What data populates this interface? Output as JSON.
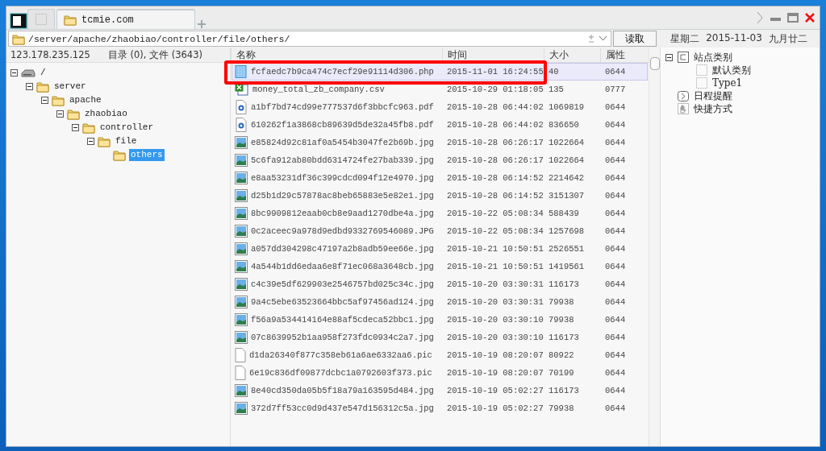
{
  "tabs": [
    {
      "kind": "blank",
      "selected": false
    },
    {
      "kind": "folder",
      "label": "tcmie.com",
      "selected": true
    }
  ],
  "address_bar": {
    "path": "/server/apache/zhaobiao/controller/file/others/",
    "button": "读取"
  },
  "left_panel": {
    "host": "123.178.235.125",
    "summary": "目录 (0), 文件 (3643)",
    "tree": [
      {
        "kind": "drive",
        "label": "/",
        "expanded": true,
        "selected": false,
        "children": [
          {
            "kind": "folder",
            "label": "server",
            "expanded": true,
            "selected": false,
            "children": [
              {
                "kind": "folder",
                "label": "apache",
                "expanded": true,
                "selected": false,
                "children": [
                  {
                    "kind": "folder",
                    "label": "zhaobiao",
                    "expanded": true,
                    "selected": false,
                    "children": [
                      {
                        "kind": "folder",
                        "label": "controller",
                        "expanded": true,
                        "selected": false,
                        "children": [
                          {
                            "kind": "folder",
                            "label": "file",
                            "expanded": true,
                            "selected": false,
                            "children": [
                              {
                                "kind": "folder",
                                "label": "others",
                                "selected": true
                              }
                            ]
                          }
                        ]
                      }
                    ]
                  }
                ]
              }
            ]
          }
        ]
      }
    ]
  },
  "file_list": {
    "columns": [
      "名称",
      "时间",
      "大小",
      "属性"
    ],
    "rows": [
      {
        "kind": "php",
        "name": "fcfaedc7b9ca474c7ecf29e91114d306.php",
        "time": "2015-11-01 16:24:55",
        "size": "40",
        "attr": "0644",
        "selected": true,
        "highlighted": true
      },
      {
        "kind": "csv",
        "name": "money_total_zb_company.csv",
        "time": "2015-10-29 01:18:05",
        "size": "135",
        "attr": "0777",
        "selected": false
      },
      {
        "kind": "pdf",
        "name": "a1bf7bd74cd99e777537d6f3bbcfc963.pdf",
        "time": "2015-10-28 06:44:02",
        "size": "1069819",
        "attr": "0644",
        "selected": false
      },
      {
        "kind": "pdf",
        "name": "610262f1a3868cb89639d5de32a45fb8.pdf",
        "time": "2015-10-28 06:44:02",
        "size": "836650",
        "attr": "0644",
        "selected": false
      },
      {
        "kind": "image",
        "name": "e85824d92c81af0a5454b3047fe2b69b.jpg",
        "time": "2015-10-28 06:26:17",
        "size": "1022664",
        "attr": "0644",
        "selected": false
      },
      {
        "kind": "image",
        "name": "5c6fa912ab80bdd6314724fe27bab339.jpg",
        "time": "2015-10-28 06:26:17",
        "size": "1022664",
        "attr": "0644",
        "selected": false
      },
      {
        "kind": "image",
        "name": "e8aa53231df36c399cdcd094f12e4970.jpg",
        "time": "2015-10-28 06:14:52",
        "size": "2214642",
        "attr": "0644",
        "selected": false
      },
      {
        "kind": "image",
        "name": "d25b1d29c57878ac8beb65883e5e82e1.jpg",
        "time": "2015-10-28 06:14:52",
        "size": "3151307",
        "attr": "0644",
        "selected": false
      },
      {
        "kind": "image",
        "name": "8bc9909812eaab0cb8e9aad1270dbe4a.jpg",
        "time": "2015-10-22 05:08:34",
        "size": "588439",
        "attr": "0644",
        "selected": false
      },
      {
        "kind": "image",
        "name": "0c2aceec9a978d9edbd9332769546089.JPG",
        "time": "2015-10-22 05:08:34",
        "size": "1257698",
        "attr": "0644",
        "selected": false
      },
      {
        "kind": "image",
        "name": "a057dd304298c47197a2b8adb59ee66e.jpg",
        "time": "2015-10-21 10:50:51",
        "size": "2526551",
        "attr": "0644",
        "selected": false
      },
      {
        "kind": "image",
        "name": "4a544b1dd6edaa6e8f71ec068a3648cb.jpg",
        "time": "2015-10-21 10:50:51",
        "size": "1419561",
        "attr": "0644",
        "selected": false
      },
      {
        "kind": "image",
        "name": "c4c39e5df629903e2546757bd025c34c.jpg",
        "time": "2015-10-20 03:30:31",
        "size": "116173",
        "attr": "0644",
        "selected": false
      },
      {
        "kind": "image",
        "name": "9a4c5ebe63523664bbc5af97456ad124.jpg",
        "time": "2015-10-20 03:30:31",
        "size": "79938",
        "attr": "0644",
        "selected": false
      },
      {
        "kind": "image",
        "name": "f56a9a534414164e88af5cdeca52bbc1.jpg",
        "time": "2015-10-20 03:30:10",
        "size": "79938",
        "attr": "0644",
        "selected": false
      },
      {
        "kind": "image",
        "name": "07c8639952b1aa958f273fdc0934c2a7.jpg",
        "time": "2015-10-20 03:30:10",
        "size": "116173",
        "attr": "0644",
        "selected": false
      },
      {
        "kind": "pic",
        "name": "d1da26340f877c358eb61a6ae6332aa6.pic",
        "time": "2015-10-19 08:20:07",
        "size": "80922",
        "attr": "0644",
        "selected": false
      },
      {
        "kind": "pic",
        "name": "6e19c836df09877dcbc1a0792603f373.pic",
        "time": "2015-10-19 08:20:07",
        "size": "70199",
        "attr": "0644",
        "selected": false
      },
      {
        "kind": "image",
        "name": "8e40cd350da05b5f18a79a163595d484.jpg",
        "time": "2015-10-19 05:02:27",
        "size": "116173",
        "attr": "0644",
        "selected": false
      },
      {
        "kind": "image",
        "name": "372d7ff53cc0d9d437e547d156312c5a.jpg",
        "time": "2015-10-19 05:02:27",
        "size": "79938",
        "attr": "0644",
        "selected": false
      }
    ]
  },
  "right_panel": {
    "weekday": "星期二",
    "date": "2015-11-03",
    "lunar_date": "九月廿二",
    "tree": [
      {
        "kind": "category",
        "label": "站点类别",
        "expanded": true,
        "children": [
          {
            "kind": "subcategory",
            "label": "默认类别"
          },
          {
            "kind": "subcategory",
            "label": "Type1"
          }
        ]
      },
      {
        "kind": "schedule",
        "label": "日程提醒"
      },
      {
        "kind": "shortcut",
        "label": "快捷方式"
      }
    ]
  }
}
